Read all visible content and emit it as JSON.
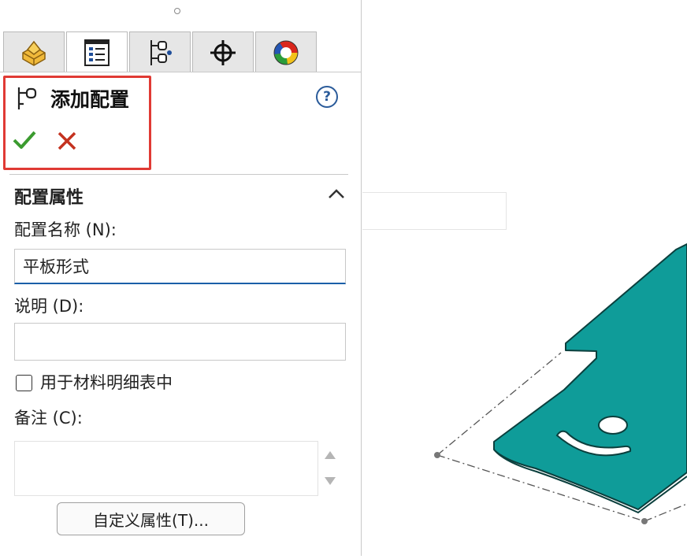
{
  "panel": {
    "tabs": [
      {
        "name": "feature-manager",
        "icon": "part-cube-icon"
      },
      {
        "name": "property-manager",
        "icon": "property-list-icon"
      },
      {
        "name": "configuration-manager",
        "icon": "configuration-tree-icon"
      },
      {
        "name": "dimxpert-manager",
        "icon": "crosshair-icon"
      },
      {
        "name": "display-manager",
        "icon": "appearance-sphere-icon"
      }
    ],
    "active_tab": 1,
    "title": "添加配置",
    "help_glyph": "?",
    "ok_icon": "green-check-icon",
    "cancel_icon": "red-x-icon",
    "highlight_color": "#e03a34",
    "section_title": "配置属性",
    "config_name_label": "配置名称 (N):",
    "config_name_value": "平板形式",
    "description_label": "说明 (D):",
    "description_value": "",
    "bom_checkbox_label": "用于材料明细表中",
    "bom_checked": false,
    "notes_label": "备注 (C):",
    "notes_value": "",
    "custom_properties_button": "自定义属性(T)..."
  },
  "viewport": {
    "part_color": "#0f9c99",
    "part_edge_color": "#0b3f3d"
  }
}
